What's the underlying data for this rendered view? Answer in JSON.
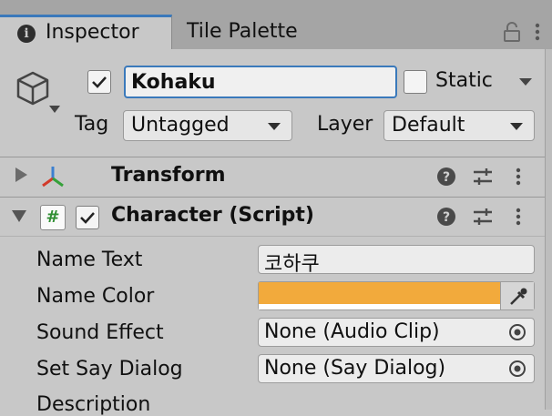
{
  "tabs": {
    "inspector": "Inspector",
    "tile_palette": "Tile Palette"
  },
  "header": {
    "object_name": "Kohaku",
    "active": true,
    "static_label": "Static",
    "static": false,
    "tag_label": "Tag",
    "tag_value": "Untagged",
    "layer_label": "Layer",
    "layer_value": "Default"
  },
  "components": {
    "transform": {
      "title": "Transform",
      "expanded": false
    },
    "character": {
      "title": "Character (Script)",
      "expanded": true,
      "enabled": true,
      "script_glyph": "#",
      "properties": {
        "name_text": {
          "label": "Name Text",
          "value": "코하쿠"
        },
        "name_color": {
          "label": "Name Color",
          "color": "#f2aa3c"
        },
        "sound_effect": {
          "label": "Sound Effect",
          "value": "None (Audio Clip)"
        },
        "set_say_dialog": {
          "label": "Set Say Dialog",
          "value": "None (Say Dialog)"
        },
        "description": {
          "label": "Description"
        }
      }
    }
  },
  "icons": {
    "info": "info-icon",
    "lock": "lock-icon",
    "menu": "kebab-menu-icon",
    "gameobject": "cube-icon",
    "transform": "transform-axes-icon",
    "help": "help-icon",
    "presets": "presets-icon",
    "more": "more-icon",
    "object_picker": "object-picker-icon",
    "eyedropper": "eyedropper-icon"
  },
  "colors": {
    "accent": "#3a79bb",
    "panel": "#c8c8c8",
    "tabbar": "#a5a5a5",
    "script_green": "#2f8e32"
  }
}
